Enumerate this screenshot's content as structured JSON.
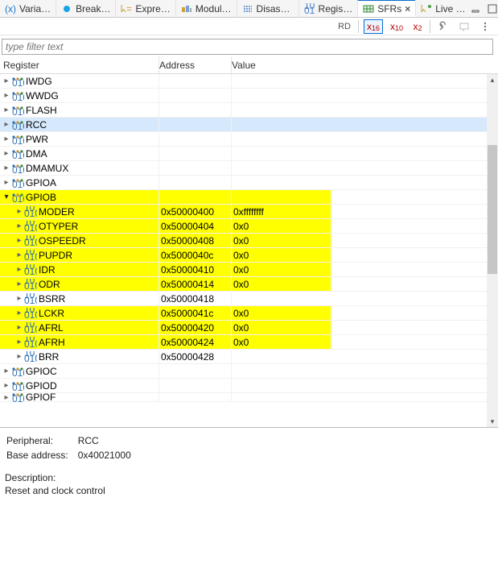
{
  "tabs": [
    {
      "label": "Varia…",
      "icon": "var",
      "iconColor": "#1478d0"
    },
    {
      "label": "Break…",
      "icon": "dot",
      "iconColor": "#1aa3e8"
    },
    {
      "label": "Expre…",
      "icon": "expr",
      "iconColor": "#caa23a"
    },
    {
      "label": "Modul…",
      "icon": "mod",
      "iconColor": "#caa23a"
    },
    {
      "label": "Disass…",
      "icon": "dis",
      "iconColor": "#4a80c9"
    },
    {
      "label": "Regis…",
      "icon": "bits",
      "iconColor": "#4a80c9"
    },
    {
      "label": "SFRs",
      "icon": "sfr",
      "iconColor": "#3a8a3a",
      "active": true,
      "closeable": true
    },
    {
      "label": "Live …",
      "icon": "live",
      "iconColor": "#caa23a"
    }
  ],
  "toolbar": {
    "rd": "RD",
    "x16": "x",
    "x16s": "16",
    "x10": "x",
    "x10s": "10",
    "x2": "x",
    "x2s": "2"
  },
  "filter": {
    "placeholder": "type filter text"
  },
  "columns": {
    "register": "Register",
    "address": "Address",
    "value": "Value"
  },
  "rows": [
    {
      "depth": 0,
      "kind": "periph",
      "label": "IWDG"
    },
    {
      "depth": 0,
      "kind": "periph",
      "label": "WWDG"
    },
    {
      "depth": 0,
      "kind": "periph",
      "label": "FLASH"
    },
    {
      "depth": 0,
      "kind": "periph",
      "label": "RCC",
      "selected": true
    },
    {
      "depth": 0,
      "kind": "periph",
      "label": "PWR"
    },
    {
      "depth": 0,
      "kind": "periph",
      "label": "DMA"
    },
    {
      "depth": 0,
      "kind": "periph",
      "label": "DMAMUX"
    },
    {
      "depth": 0,
      "kind": "periph",
      "label": "GPIOA"
    },
    {
      "depth": 0,
      "kind": "periph",
      "label": "GPIOB",
      "expanded": true,
      "highlight": true
    },
    {
      "depth": 1,
      "kind": "reg",
      "label": "MODER",
      "addr": "0x50000400",
      "val": "0xffffffff",
      "highlight": true
    },
    {
      "depth": 1,
      "kind": "reg",
      "label": "OTYPER",
      "addr": "0x50000404",
      "val": "0x0",
      "highlight": true
    },
    {
      "depth": 1,
      "kind": "reg",
      "label": "OSPEEDR",
      "addr": "0x50000408",
      "val": "0x0",
      "highlight": true
    },
    {
      "depth": 1,
      "kind": "reg",
      "label": "PUPDR",
      "addr": "0x5000040c",
      "val": "0x0",
      "highlight": true
    },
    {
      "depth": 1,
      "kind": "reg",
      "label": "IDR",
      "addr": "0x50000410",
      "val": "0x0",
      "highlight": true
    },
    {
      "depth": 1,
      "kind": "reg",
      "label": "ODR",
      "addr": "0x50000414",
      "val": "0x0",
      "highlight": true
    },
    {
      "depth": 1,
      "kind": "reg",
      "label": "BSRR",
      "addr": "0x50000418",
      "val": ""
    },
    {
      "depth": 1,
      "kind": "reg",
      "label": "LCKR",
      "addr": "0x5000041c",
      "val": "0x0",
      "highlight": true
    },
    {
      "depth": 1,
      "kind": "reg",
      "label": "AFRL",
      "addr": "0x50000420",
      "val": "0x0",
      "highlight": true
    },
    {
      "depth": 1,
      "kind": "reg",
      "label": "AFRH",
      "addr": "0x50000424",
      "val": "0x0",
      "highlight": true
    },
    {
      "depth": 1,
      "kind": "reg",
      "label": "BRR",
      "addr": "0x50000428",
      "val": ""
    },
    {
      "depth": 0,
      "kind": "periph",
      "label": "GPIOC"
    },
    {
      "depth": 0,
      "kind": "periph",
      "label": "GPIOD"
    },
    {
      "depth": 0,
      "kind": "periph",
      "label": "GPIOF",
      "cut": true
    }
  ],
  "detail": {
    "k_periph": "Peripheral:",
    "v_periph": "RCC",
    "k_base": "Base address:",
    "v_base": "0x40021000",
    "k_desc": "Description:",
    "v_desc": "Reset and clock control"
  }
}
